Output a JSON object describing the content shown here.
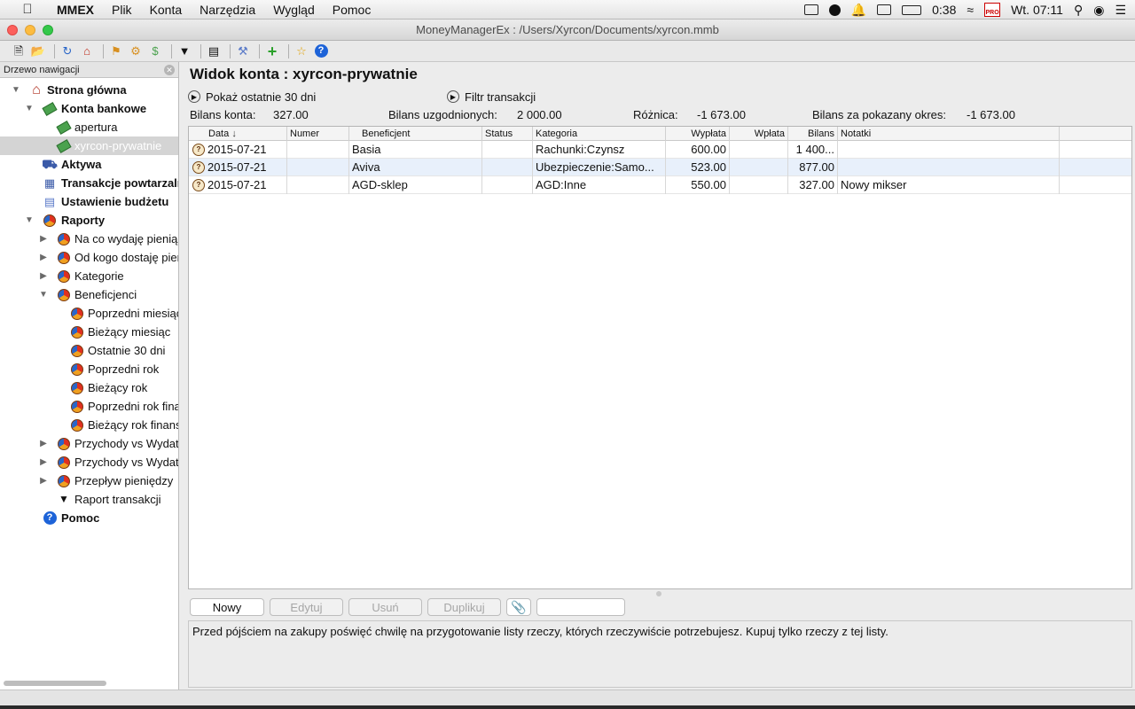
{
  "menubar": {
    "app_name": "MMEX",
    "items": [
      "Plik",
      "Konta",
      "Narzędzia",
      "Wygląd",
      "Pomoc"
    ],
    "time_remaining": "0:38",
    "clock": "Wt. 07:11",
    "pro_badge": "PRO"
  },
  "window": {
    "title": "MoneyManagerEx : /Users/Xyrcon/Documents/xyrcon.mmb"
  },
  "sidebar": {
    "header": "Drzewo nawigacji",
    "items": [
      {
        "label": "Strona główna"
      },
      {
        "label": "Konta bankowe"
      },
      {
        "label": "apertura"
      },
      {
        "label": "xyrcon-prywatnie"
      },
      {
        "label": "Aktywa"
      },
      {
        "label": "Transakcje powtarzalne"
      },
      {
        "label": "Ustawienie budżetu"
      },
      {
        "label": "Raporty"
      },
      {
        "label": "Na co wydaję pieniądze"
      },
      {
        "label": "Od kogo dostaję pieniądze"
      },
      {
        "label": "Kategorie"
      },
      {
        "label": "Beneficjenci"
      },
      {
        "label": "Poprzedni miesiąc"
      },
      {
        "label": "Bieżący miesiąc"
      },
      {
        "label": "Ostatnie 30 dni"
      },
      {
        "label": "Poprzedni rok"
      },
      {
        "label": "Bieżący rok"
      },
      {
        "label": "Poprzedni rok finansowy"
      },
      {
        "label": "Bieżący rok finansowy"
      },
      {
        "label": "Przychody vs Wydatki"
      },
      {
        "label": "Przychody vs Wydatki"
      },
      {
        "label": "Przepływ pieniędzy"
      },
      {
        "label": "Raport transakcji"
      },
      {
        "label": "Pomoc"
      }
    ]
  },
  "account": {
    "title": "Widok konta : xyrcon-prywatnie",
    "show_last_30": "Pokaż ostatnie 30 dni",
    "filter": "Filtr transakcji",
    "balance_label": "Bilans konta:",
    "balance_value": "327.00",
    "reconciled_label": "Bilans uzgodnionych:",
    "reconciled_value": "2 000.00",
    "diff_label": "Różnica:",
    "diff_value": "-1 673.00",
    "period_label": "Bilans za pokazany okres:",
    "period_value": "-1 673.00"
  },
  "table": {
    "columns": [
      "Data",
      "Numer",
      "Beneficjent",
      "Status",
      "Kategoria",
      "Wypłata",
      "Wpłata",
      "Bilans",
      "Notatki"
    ],
    "rows": [
      {
        "date": "2015-07-21",
        "number": "",
        "payee": "Basia",
        "status": "",
        "category": "Rachunki:Czynsz",
        "withdrawal": "600.00",
        "deposit": "",
        "balance": "1 400...",
        "notes": ""
      },
      {
        "date": "2015-07-21",
        "number": "",
        "payee": "Aviva",
        "status": "",
        "category": "Ubezpieczenie:Samo...",
        "withdrawal": "523.00",
        "deposit": "",
        "balance": "877.00",
        "notes": ""
      },
      {
        "date": "2015-07-21",
        "number": "",
        "payee": "AGD-sklep",
        "status": "",
        "category": "AGD:Inne",
        "withdrawal": "550.00",
        "deposit": "",
        "balance": "327.00",
        "notes": "Nowy mikser"
      }
    ]
  },
  "actions": {
    "new": "Nowy",
    "edit": "Edytuj",
    "delete": "Usuń",
    "duplicate": "Duplikuj",
    "search_value": ""
  },
  "tip": "Przed pójściem na zakupy poświęć chwilę na przygotowanie listy rzeczy, których rzeczywiście potrzebujesz. Kupuj tylko rzeczy z tej listy.",
  "colors": {
    "accent": "#1d63d8",
    "selected_row": "#e8f0fb",
    "sidebar_selected": "#d4d4d4"
  }
}
